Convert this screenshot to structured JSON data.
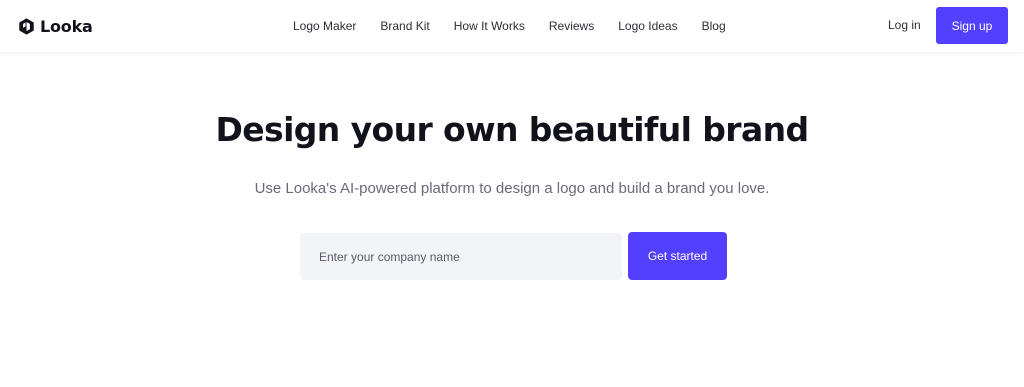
{
  "header": {
    "brand": {
      "name": "Looka",
      "logo_icon": "looka-logo-icon"
    },
    "nav": [
      {
        "label": "Logo Maker"
      },
      {
        "label": "Brand Kit"
      },
      {
        "label": "How It Works"
      },
      {
        "label": "Reviews"
      },
      {
        "label": "Logo Ideas"
      },
      {
        "label": "Blog"
      }
    ],
    "login_label": "Log in",
    "signup_label": "Sign up"
  },
  "hero": {
    "title": "Design your own beautiful brand",
    "subtitle": "Use Looka's AI-powered platform to design a logo and build a brand you love.",
    "input": {
      "placeholder": "Enter your company name",
      "value": ""
    },
    "cta_label": "Get started"
  },
  "colors": {
    "accent": "#5340ff",
    "title": "#12121c",
    "subtitle": "#6a6a78",
    "input_bg": "#f3f4f8"
  }
}
